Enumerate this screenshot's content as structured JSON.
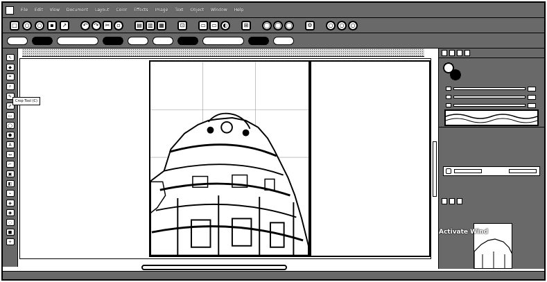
{
  "menubar": {
    "items": [
      "File",
      "Edit",
      "View",
      "Document",
      "Layout",
      "Color",
      "Effects",
      "Image",
      "Text",
      "Object",
      "Window",
      "Help"
    ]
  },
  "toolbar": {
    "left_icons": [
      "new-icon",
      "open-icon",
      "save-icon",
      "print-icon",
      "share-icon"
    ],
    "group_count_labels": []
  },
  "tooltip": {
    "text": "Crop Tool (C)"
  },
  "watermark": {
    "text": "Activate Wind"
  },
  "colors": {
    "dither": "#8c8c8c",
    "ink": "#000000",
    "paper": "#ffffff"
  }
}
